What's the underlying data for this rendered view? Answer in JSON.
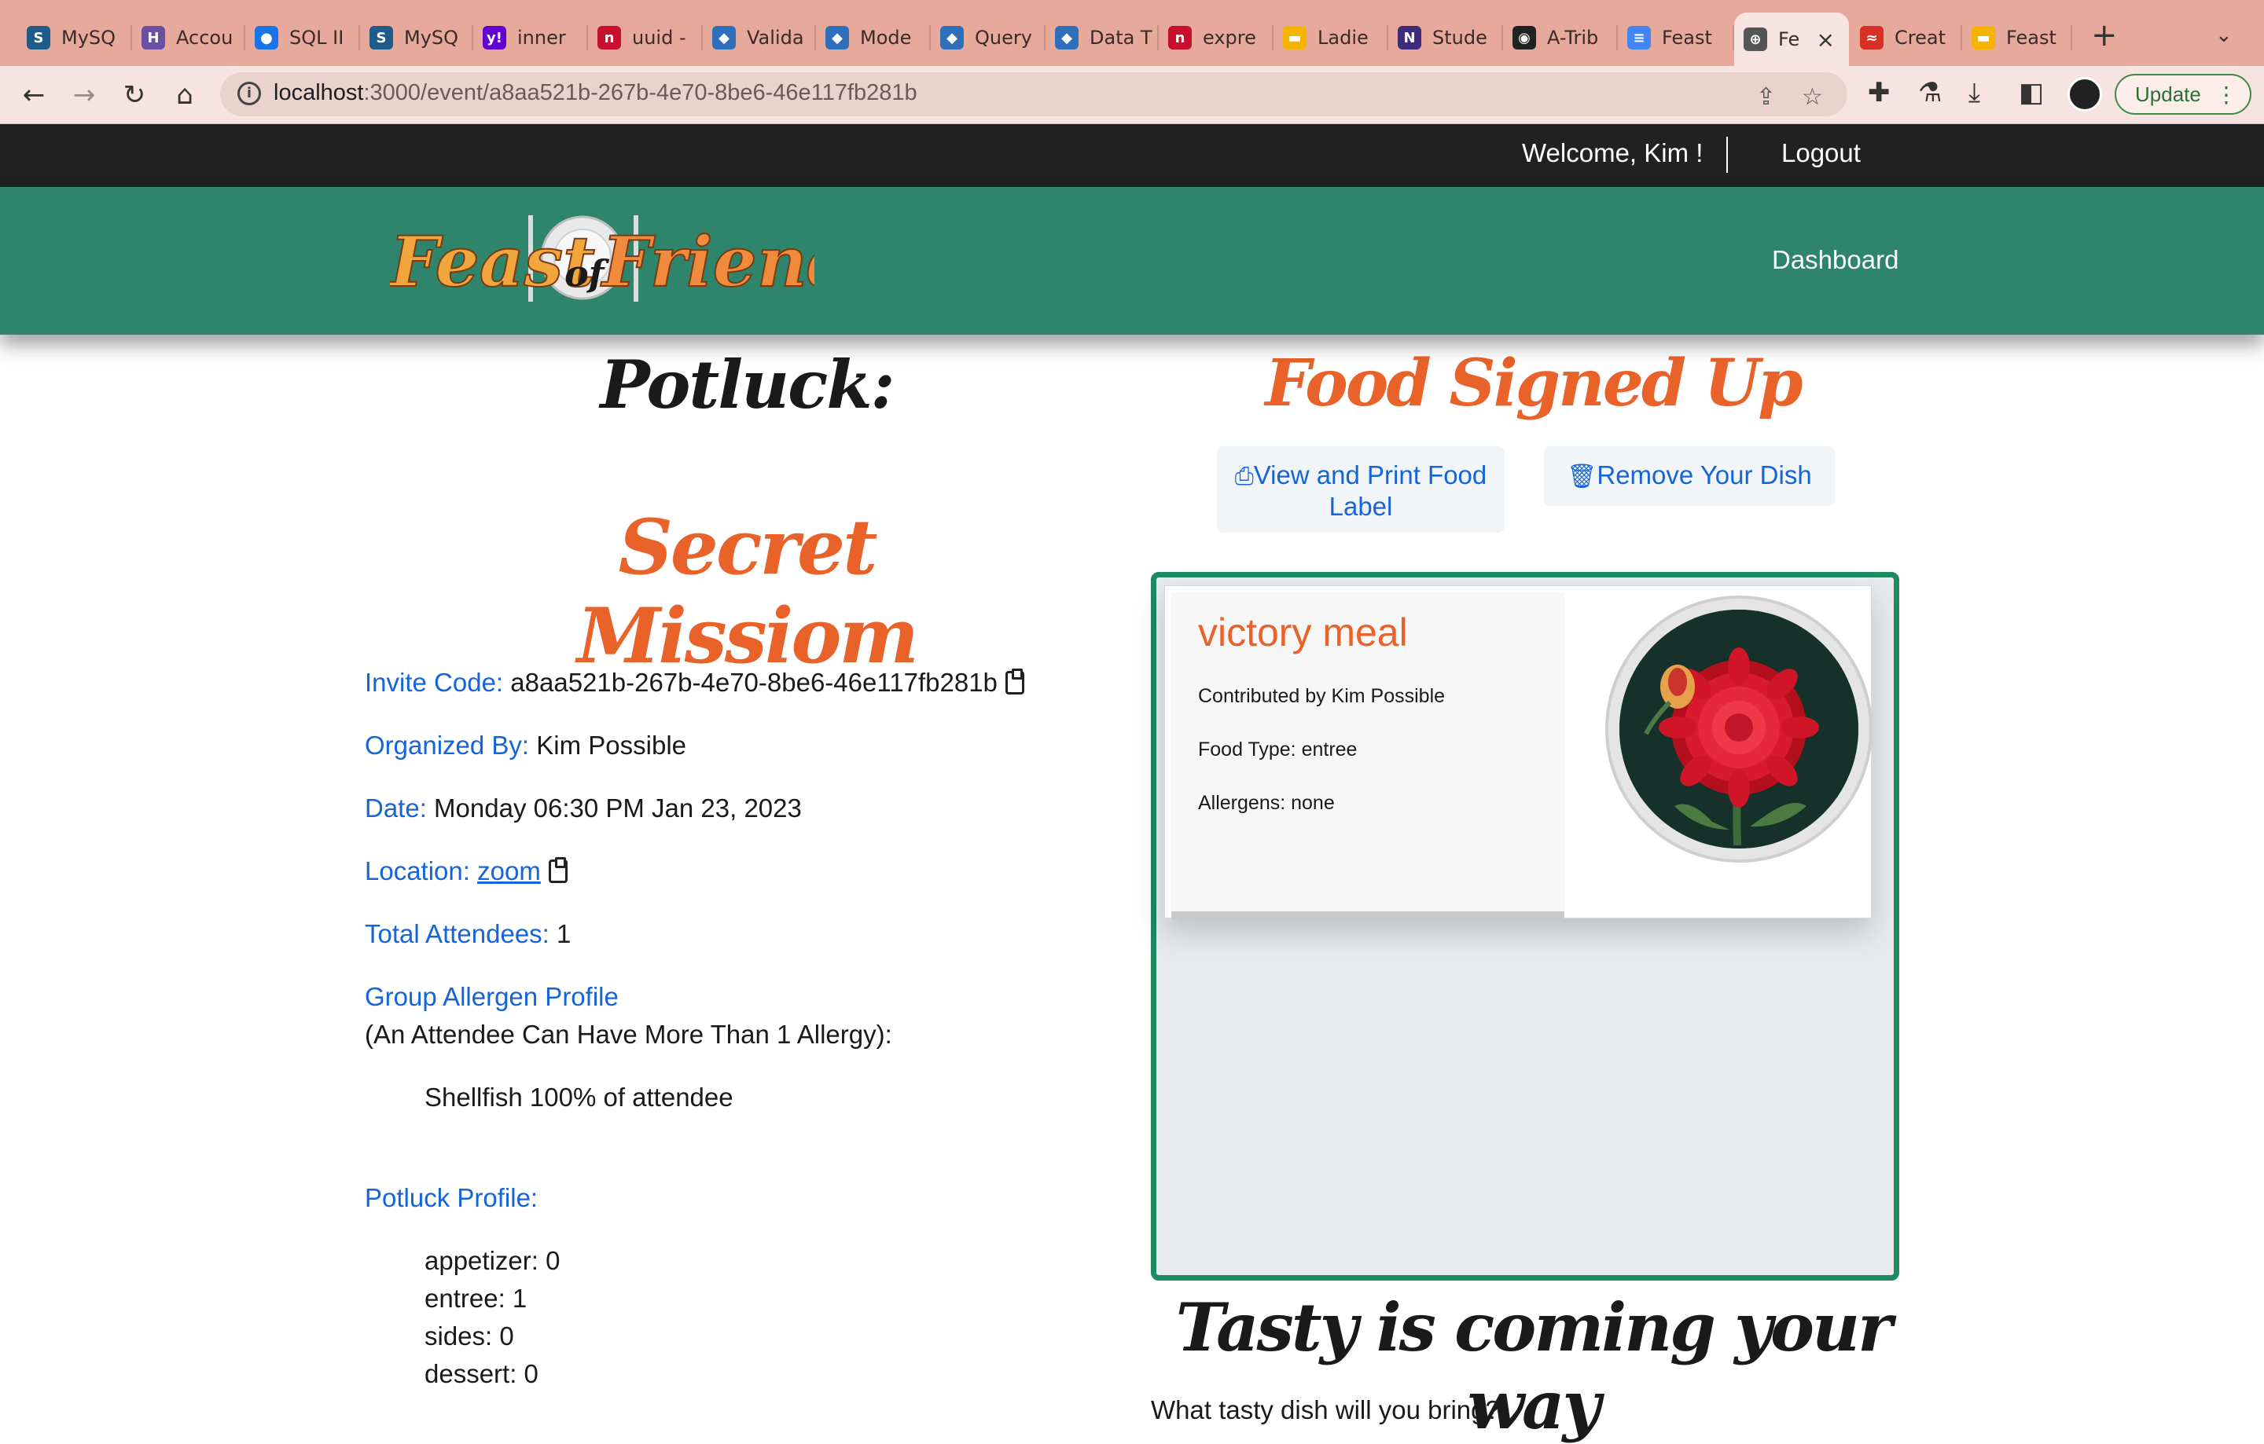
{
  "browser": {
    "tabs": [
      {
        "label": "MySQ",
        "icon": "mysql-icon",
        "color": "#1f5c8a",
        "glyph": "S"
      },
      {
        "label": "Accou",
        "icon": "heroku-icon",
        "color": "#6a4fa3",
        "glyph": "H"
      },
      {
        "label": "SQL II",
        "icon": "dot-icon",
        "color": "#1a73e8",
        "glyph": "●"
      },
      {
        "label": "MySQ",
        "icon": "mysql-icon",
        "color": "#1f5c8a",
        "glyph": "S"
      },
      {
        "label": "inner",
        "icon": "yahoo-icon",
        "color": "#6001d2",
        "glyph": "y!"
      },
      {
        "label": "uuid -",
        "icon": "npm-icon",
        "color": "#c8102e",
        "glyph": "n"
      },
      {
        "label": "Valida",
        "icon": "sequelize-icon",
        "color": "#2f6fba",
        "glyph": "◆"
      },
      {
        "label": "Mode",
        "icon": "sequelize-icon",
        "color": "#2f6fba",
        "glyph": "◆"
      },
      {
        "label": "Query",
        "icon": "sequelize-icon",
        "color": "#2f6fba",
        "glyph": "◆"
      },
      {
        "label": "Data T",
        "icon": "sequelize-icon",
        "color": "#2f6fba",
        "glyph": "◆"
      },
      {
        "label": "expre",
        "icon": "npm-icon",
        "color": "#c8102e",
        "glyph": "n"
      },
      {
        "label": "Ladie",
        "icon": "slides-icon",
        "color": "#f4b400",
        "glyph": "▬"
      },
      {
        "label": "Stude",
        "icon": "notion-icon",
        "color": "#3d2a7a",
        "glyph": "N"
      },
      {
        "label": "A-Trib",
        "icon": "github-icon",
        "color": "#222222",
        "glyph": "◉"
      },
      {
        "label": "Feast",
        "icon": "docs-icon",
        "color": "#4285f4",
        "glyph": "≡"
      },
      {
        "label": "Fe",
        "icon": "globe-icon",
        "color": "#555555",
        "glyph": "⊕",
        "active": true
      },
      {
        "label": "Creat",
        "icon": "flag-icon",
        "color": "#d93025",
        "glyph": "≈"
      },
      {
        "label": "Feast",
        "icon": "slides-icon",
        "color": "#f4b400",
        "glyph": "▬"
      }
    ],
    "url_host": "localhost",
    "url_rest": ":3000/event/a8aa521b-267b-4e70-8be6-46e117fb281b",
    "update_label": "Update"
  },
  "header": {
    "welcome": "Welcome, Kim !",
    "logout": "Logout",
    "logo_text_1": "Feast",
    "logo_text_2": "of",
    "logo_text_3": "Friends",
    "dashboard": "Dashboard"
  },
  "event": {
    "heading": "Potluck:",
    "name": "Secret Missiom",
    "invite_label": "Invite Code:",
    "invite_code": "a8aa521b-267b-4e70-8be6-46e117fb281b",
    "organized_label": "Organized By:",
    "organizer": "Kim Possible",
    "date_label": "Date:",
    "date": "Monday 06:30 PM Jan 23, 2023",
    "location_label": "Location:",
    "location": "zoom",
    "attendees_label": "Total Attendees:",
    "attendees": "1",
    "allergen_label": "Group Allergen Profile",
    "allergen_note": "(An Attendee Can Have More Than 1 Allergy):",
    "allergen_item": "Shellfish 100% of attendee",
    "profile_label": "Potluck Profile:",
    "profile_items": [
      "appetizer: 0",
      "entree: 1",
      "sides: 0",
      "dessert: 0"
    ]
  },
  "food": {
    "heading": "Food Signed Up",
    "print_label": "View and Print Food Label",
    "remove_label": "Remove Your Dish",
    "dish_name": "victory meal",
    "contributed": "Contributed by Kim Possible",
    "food_type": "Food Type: entree",
    "allergens": "Allergens: none",
    "tasty_heading": "Tasty is coming your way",
    "question": "What tasty dish will you bring?"
  },
  "colors": {
    "accent_orange": "#e8622a",
    "nav_green": "#2e856c",
    "link_blue": "#1565d8",
    "panel_border": "#1d8a62"
  }
}
